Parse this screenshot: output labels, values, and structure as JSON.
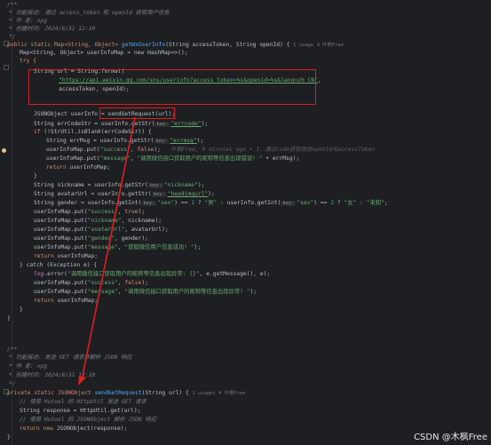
{
  "editor": {
    "doc1": {
      "open": "/**",
      "feature_label": "* 功能描述:",
      "feature_text": "通过 access_token 和 openId 获取用户信息",
      "author_label": "* 作 者:",
      "author": "xpg",
      "time_label": "* 创建时间:",
      "time": "2024/8/31 12:10",
      "close": "*/"
    },
    "m1": {
      "sig_a": "public static Map<String, Object> ",
      "name": "getWxUserInfo",
      "sig_b": "(String accessToken, String openId) {",
      "usages": "1 usage",
      "author_hint": "4 叶枫Free"
    },
    "l_map": "Map<String, Object> userInfoMap = new HashMap<>();",
    "l_try": "try {",
    "l_url1a": "String url = String.",
    "l_url1b": "format",
    "l_url1c": "(",
    "url_str": "\"https://api.weixin.qq.com/sns/userinfo?access_token=%s&openid=%s&lang=zh_CN\"",
    "l_url3": "accessToken, openId);",
    "l_json_a": "JSONObject userInfo = ",
    "l_json_b": "sendGetRequest(url);",
    "l_err_a": "String errCodeStr = userInfo.getStr(",
    "hint_key": "key:",
    "errcode": "\"errcode\"",
    "l_if": "if (!StrUtil.isBlank(errCodeStr)) {",
    "l_errmsg_a": "String errMsg = userInfo.getStr(",
    "errmsg": "\"errmsg\"",
    "l_put_a": "userInfoMap.put(",
    "success": "\"success\"",
    "false_kw": "false",
    "ghost_blame": "叶枫Free, 8 minutes ago • 1、通过code获取微信openId与accessToken",
    "message": "\"message\"",
    "msg_err_a": "\"调用微信接口获取用户的昵称等信息出现错误! \"",
    "plus_errmsg": " + errMsg);",
    "l_return": "return userInfoMap;",
    "l_close": "}",
    "l_nick_a": "String nickname = userInfo.getStr(",
    "nickname": "\"nickname\"",
    "l_avatar_a": "String avatarUrl = userInfo.getStr(",
    "headimgurl": "\"headimgurl\"",
    "l_gender_a": "String gender = userInfo.getInt(",
    "sex": "\"sex\"",
    "male": "\"男\"",
    "female": "\"女\"",
    "unknown": "\"未知\"",
    "true_kw": "true",
    "nick_key": "\"nickname\"",
    "avatar_key": "\"avatarUrl\"",
    "gender_key": "\"gender\"",
    "msg_ok": "\"获取微信用户信息成功! \"",
    "l_catch": "} catch (Exception e) {",
    "log_a": "log",
    "log_str": "\"调用微信接口获取用户的昵称等信息出现异常: {}\"",
    "log_b": ", e.getMessage(), e);",
    "msg_exc": "\"调用微信接口获取用户的昵称等信息出现异常! \"",
    "doc2": {
      "open": "/**",
      "feature_label": "* 功能描述:",
      "feature_text": "发送 GET 请求并解析 JSON 响应",
      "author_label": "* 作 者:",
      "author": "xpg",
      "time_label": "* 创建时间:",
      "time": "2024/8/31 12:10",
      "close": "*/"
    },
    "m2": {
      "sig_a": "private static JSONObject ",
      "name": "sendGetRequest",
      "sig_b": "(String url) {",
      "usages": "2 usages",
      "author_hint": "4 叶枫Free"
    },
    "c1": "// 使用 Hutool 的 HttpUtil 发送 GET 请求",
    "l_resp": "String response = HttpUtil.get(url);",
    "c2": "// 使用 Hutool 的 JSONObject 解析 JSON 响应",
    "l_ret2": "return new JSONObject(response);"
  },
  "watermark": "CSDN @木枫Free",
  "colors": {
    "highlight_box": "#e01e1e",
    "arrow": "#e01e1e",
    "background": "#1e1f22"
  }
}
